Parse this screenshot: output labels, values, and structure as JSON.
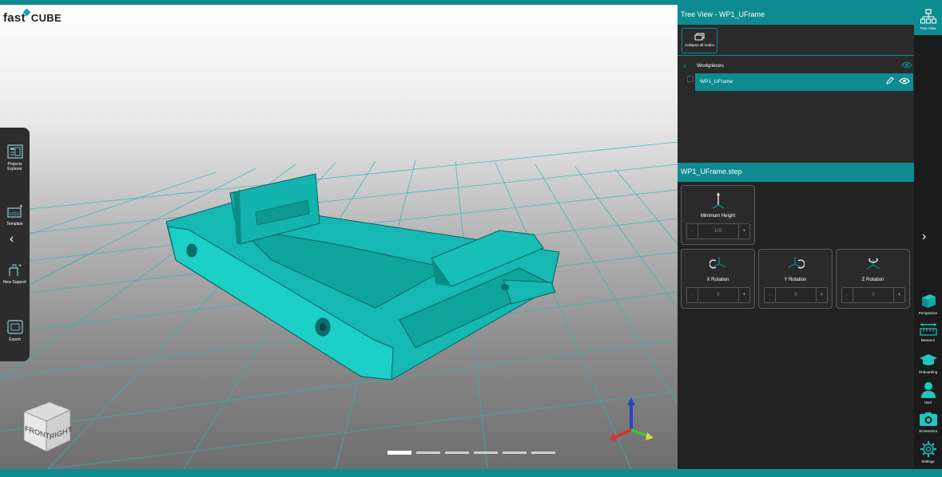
{
  "brand": {
    "logo_fast": "fast",
    "logo_cube": "CUBE"
  },
  "left_toolbar": {
    "items": [
      {
        "label": "Projects Explorer",
        "icon": "projects-explorer-icon"
      },
      {
        "label": "Template",
        "icon": "template-icon"
      },
      {
        "label": "New Support",
        "icon": "new-support-icon"
      },
      {
        "label": "Export",
        "icon": "export-icon"
      }
    ],
    "collapse_glyph": "‹"
  },
  "view_cube": {
    "front": "FRONT",
    "right": "RIGHT"
  },
  "pager": {
    "count": 6,
    "active_index": 0
  },
  "tree_view": {
    "title": "Tree View - WP1_UFrame",
    "collapse_label": "Collapse all nodes",
    "root_label": "Workpieces",
    "item_label": "WP1_UFrame"
  },
  "file_panel": {
    "title": "WP1_UFrame.step",
    "min_height": {
      "label": "Minimum Height",
      "value": "100",
      "minus": "-",
      "plus": "+"
    },
    "x_rotation": {
      "label": "X Rotation",
      "value": "0",
      "minus": "-",
      "plus": "+"
    },
    "y_rotation": {
      "label": "Y Rotation",
      "value": "0",
      "minus": "-",
      "plus": "+"
    },
    "z_rotation": {
      "label": "Z Rotation",
      "value": "0",
      "minus": "-",
      "plus": "+"
    }
  },
  "right_sidebar": {
    "tree_view_label": "Tree View",
    "expand_glyph": "›",
    "items": [
      {
        "label": "Perspective",
        "icon": "perspective-cube-icon"
      },
      {
        "label": "Measure",
        "icon": "measure-icon"
      },
      {
        "label": "Onboarding",
        "icon": "graduation-cap-icon"
      },
      {
        "label": "User",
        "icon": "user-icon"
      },
      {
        "label": "Screenshot",
        "icon": "camera-icon"
      },
      {
        "label": "Settings",
        "icon": "gear-icon"
      }
    ]
  },
  "colors": {
    "accent": "#0e8b90",
    "model": "#1ec8c0",
    "panel": "#1f1f1f"
  }
}
